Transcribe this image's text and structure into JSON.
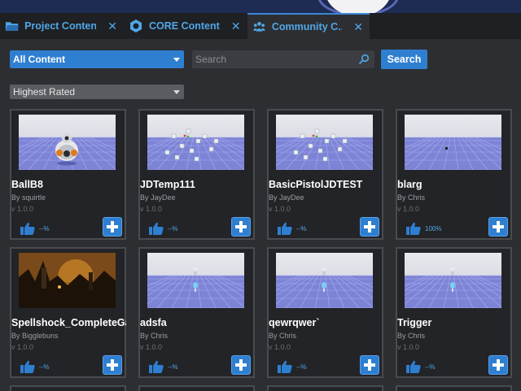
{
  "tabs": [
    {
      "label": "Project Content",
      "icon": "folder-icon",
      "close": "✕",
      "active": false
    },
    {
      "label": "CORE Content",
      "icon": "core-hex-icon",
      "close": "✕",
      "active": false
    },
    {
      "label": "Community C...",
      "icon": "community-icon",
      "close": "✕",
      "active": true
    }
  ],
  "filters": {
    "content_filter": "All Content",
    "sort": "Highest Rated"
  },
  "search": {
    "placeholder": "Search",
    "button_label": "Search"
  },
  "colors": {
    "accent": "#2f7fd1",
    "tab_text": "#4fa7e8",
    "panel_bg": "#2d2e31",
    "card_bg": "#232427"
  },
  "cards": [
    {
      "title": "BallB8",
      "author": "By squirtle",
      "version": "v 1.0.0",
      "rating": "--%",
      "thumb": "robot-ball"
    },
    {
      "title": "JDTemp111",
      "author": "By JayDee",
      "version": "v 1.0.0",
      "rating": "--%",
      "thumb": "scatter"
    },
    {
      "title": "BasicPistolJDTEST",
      "author": "By JayDee",
      "version": "v 1.0.0",
      "rating": "--%",
      "thumb": "scatter"
    },
    {
      "title": "blarg",
      "author": "By Chris",
      "version": "v 1.0.0",
      "rating": "100%",
      "thumb": "plain"
    },
    {
      "title": "Spellshock_CompleteGa",
      "author": "By Bigglebuns",
      "version": "v 1.0.0",
      "rating": "--%",
      "thumb": "castle"
    },
    {
      "title": "adsfa",
      "author": "By Chris",
      "version": "v 1.0.0",
      "rating": "--%",
      "thumb": "figure"
    },
    {
      "title": "qewrqwer`",
      "author": "By Chris",
      "version": "v 1.0.0",
      "rating": "--%",
      "thumb": "figure"
    },
    {
      "title": "Trigger",
      "author": "By Chris",
      "version": "v 1.0.0",
      "rating": "--%",
      "thumb": "figure"
    }
  ]
}
